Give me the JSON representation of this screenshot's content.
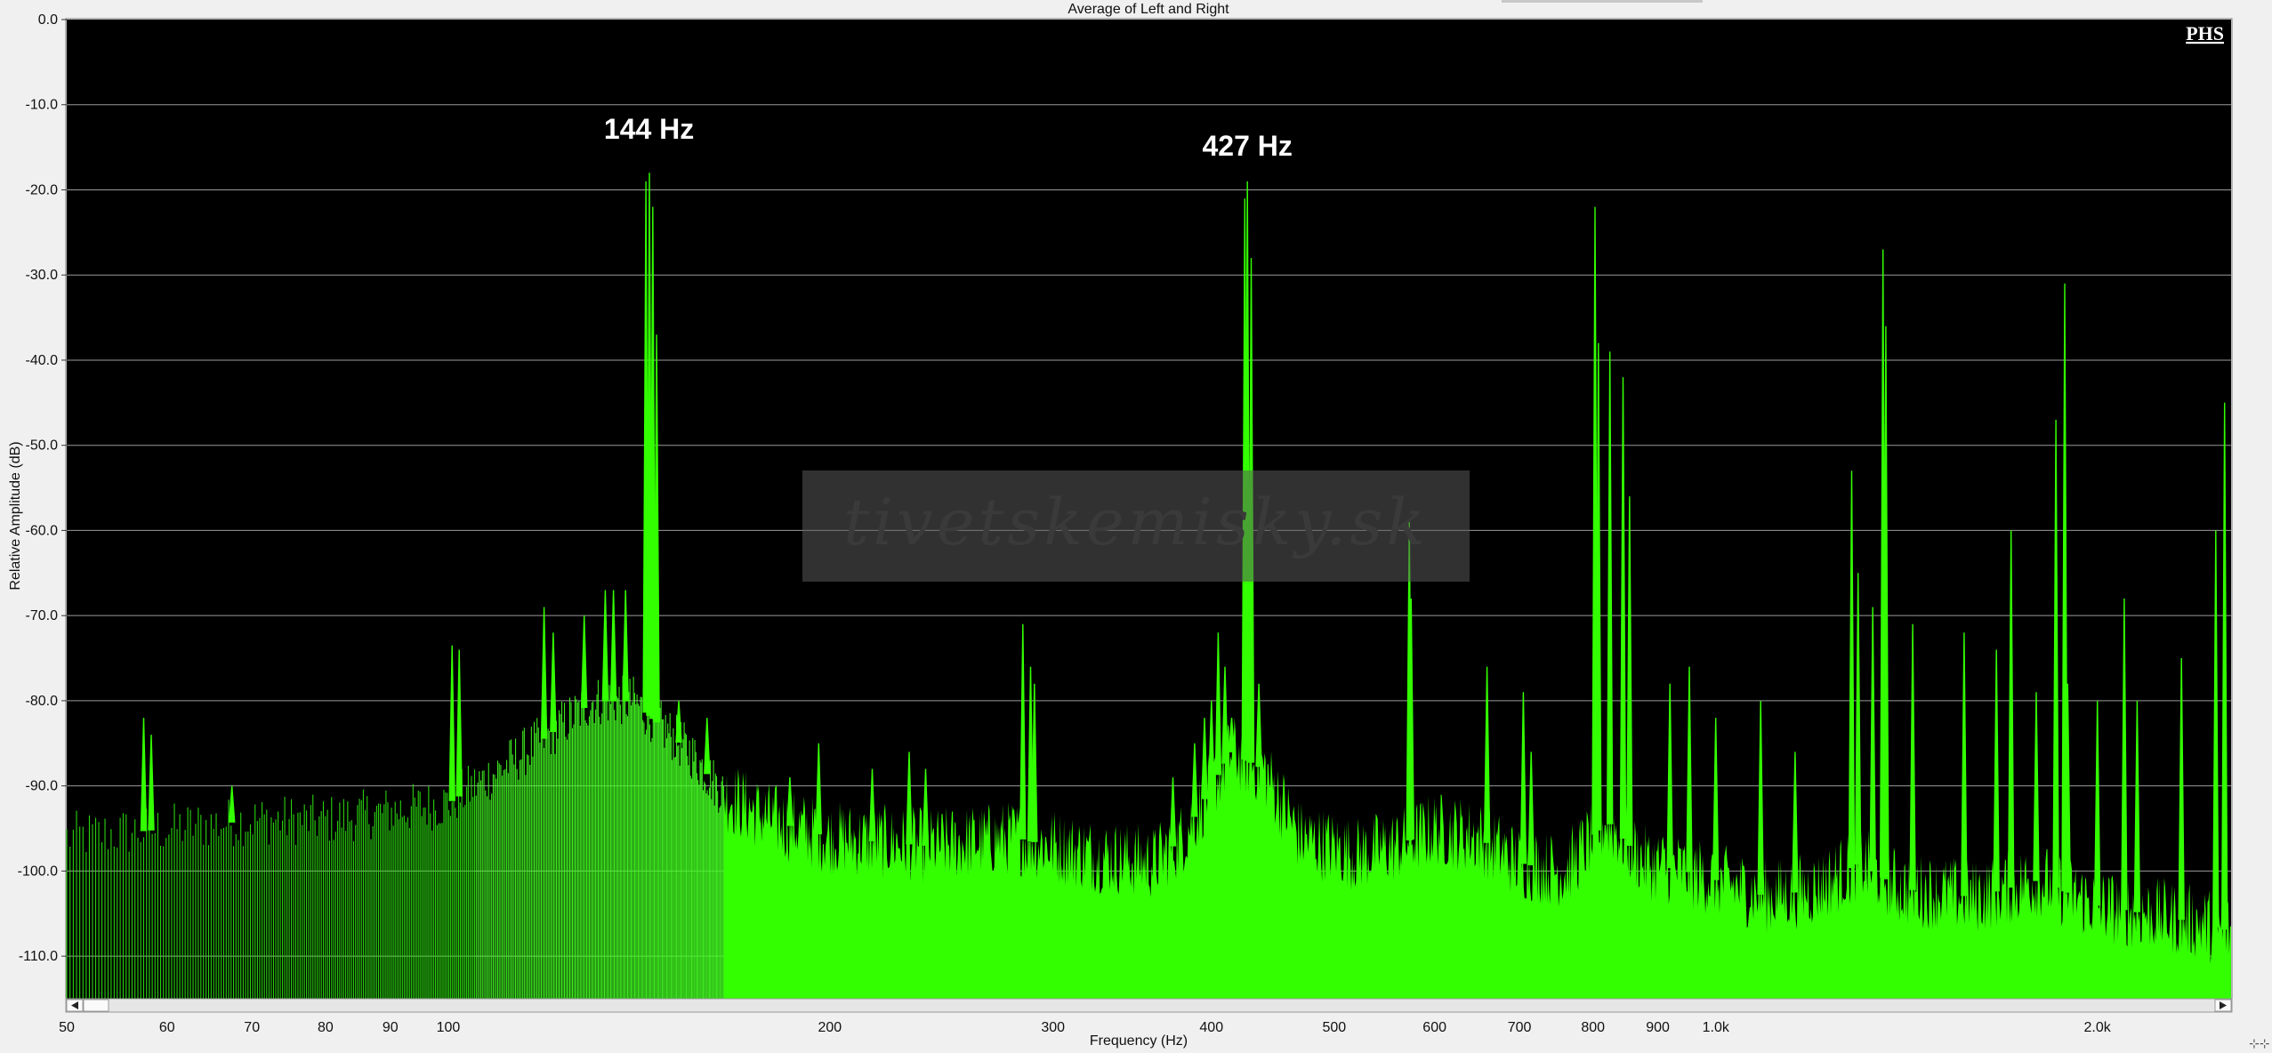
{
  "window": {
    "tab_stub": ""
  },
  "chart_data": {
    "type": "area",
    "title": "Average of Left and Right",
    "xlabel": "Frequency (Hz)",
    "ylabel": "Relative Amplitude (dB)",
    "xscale": "log",
    "xlim": [
      50,
      2550
    ],
    "ylim": [
      -115,
      0
    ],
    "grid": true,
    "background": "#000000",
    "fill_color": "#33ff00",
    "x_ticks": [
      {
        "value": 50,
        "label": "50"
      },
      {
        "value": 60,
        "label": "60"
      },
      {
        "value": 70,
        "label": "70"
      },
      {
        "value": 80,
        "label": "80"
      },
      {
        "value": 90,
        "label": "90"
      },
      {
        "value": 100,
        "label": "100"
      },
      {
        "value": 200,
        "label": "200"
      },
      {
        "value": 300,
        "label": "300"
      },
      {
        "value": 400,
        "label": "400"
      },
      {
        "value": 500,
        "label": "500"
      },
      {
        "value": 600,
        "label": "600"
      },
      {
        "value": 700,
        "label": "700"
      },
      {
        "value": 800,
        "label": "800"
      },
      {
        "value": 900,
        "label": "900"
      },
      {
        "value": 1000,
        "label": "1.0k"
      },
      {
        "value": 2000,
        "label": "2.0k"
      }
    ],
    "y_ticks": [
      {
        "value": 0,
        "label": "0.0"
      },
      {
        "value": -10,
        "label": "-10.0"
      },
      {
        "value": -20,
        "label": "-20.0"
      },
      {
        "value": -30,
        "label": "-30.0"
      },
      {
        "value": -40,
        "label": "-40.0"
      },
      {
        "value": -50,
        "label": "-50.0"
      },
      {
        "value": -60,
        "label": "-60.0"
      },
      {
        "value": -70,
        "label": "-70.0"
      },
      {
        "value": -80,
        "label": "-80.0"
      },
      {
        "value": -90,
        "label": "-90.0"
      },
      {
        "value": -100,
        "label": "-100.0"
      },
      {
        "value": -110,
        "label": "-110.0"
      }
    ],
    "annotations": [
      {
        "text": "144 Hz",
        "x": 144,
        "y": -14
      },
      {
        "text": "427 Hz",
        "x": 427,
        "y": -16
      }
    ],
    "brand_mark": "PHS",
    "watermark": "tivetskemisky.sk",
    "noise_floor": [
      [
        50,
        -96
      ],
      [
        60,
        -95
      ],
      [
        70,
        -94
      ],
      [
        80,
        -94
      ],
      [
        90,
        -93
      ],
      [
        100,
        -92
      ],
      [
        110,
        -88
      ],
      [
        120,
        -84
      ],
      [
        130,
        -80
      ],
      [
        140,
        -80
      ],
      [
        155,
        -86
      ],
      [
        165,
        -91
      ],
      [
        180,
        -94
      ],
      [
        200,
        -96
      ],
      [
        240,
        -97
      ],
      [
        280,
        -96
      ],
      [
        320,
        -98
      ],
      [
        360,
        -99
      ],
      [
        380,
        -96
      ],
      [
        400,
        -90
      ],
      [
        415,
        -86
      ],
      [
        440,
        -88
      ],
      [
        470,
        -96
      ],
      [
        520,
        -98
      ],
      [
        560,
        -97
      ],
      [
        600,
        -95
      ],
      [
        650,
        -96
      ],
      [
        700,
        -99
      ],
      [
        760,
        -100
      ],
      [
        820,
        -94
      ],
      [
        880,
        -99
      ],
      [
        950,
        -100
      ],
      [
        1000,
        -101
      ],
      [
        1100,
        -103
      ],
      [
        1200,
        -102
      ],
      [
        1300,
        -99
      ],
      [
        1400,
        -102
      ],
      [
        1600,
        -103
      ],
      [
        1800,
        -101
      ],
      [
        2000,
        -104
      ],
      [
        2200,
        -105
      ],
      [
        2400,
        -106
      ],
      [
        2550,
        -107
      ]
    ],
    "peaks": [
      {
        "x": 57.5,
        "y": -82
      },
      {
        "x": 58.3,
        "y": -84
      },
      {
        "x": 67.5,
        "y": -90
      },
      {
        "x": 100.7,
        "y": -73.5
      },
      {
        "x": 102,
        "y": -74
      },
      {
        "x": 119,
        "y": -69
      },
      {
        "x": 121,
        "y": -72
      },
      {
        "x": 128,
        "y": -70
      },
      {
        "x": 133,
        "y": -67
      },
      {
        "x": 135,
        "y": -67
      },
      {
        "x": 138,
        "y": -67
      },
      {
        "x": 143.2,
        "y": -19
      },
      {
        "x": 144.1,
        "y": -18
      },
      {
        "x": 145,
        "y": -22
      },
      {
        "x": 146,
        "y": -37
      },
      {
        "x": 152,
        "y": -80
      },
      {
        "x": 160,
        "y": -82
      },
      {
        "x": 186,
        "y": -89
      },
      {
        "x": 196,
        "y": -85
      },
      {
        "x": 216,
        "y": -88
      },
      {
        "x": 231,
        "y": -86
      },
      {
        "x": 238,
        "y": -88
      },
      {
        "x": 284,
        "y": -71
      },
      {
        "x": 288,
        "y": -76
      },
      {
        "x": 290,
        "y": -78
      },
      {
        "x": 373,
        "y": -89
      },
      {
        "x": 388,
        "y": -85
      },
      {
        "x": 395,
        "y": -82
      },
      {
        "x": 400,
        "y": -80
      },
      {
        "x": 405,
        "y": -72
      },
      {
        "x": 410,
        "y": -76
      },
      {
        "x": 415,
        "y": -82
      },
      {
        "x": 425,
        "y": -21
      },
      {
        "x": 427,
        "y": -19
      },
      {
        "x": 430,
        "y": -28
      },
      {
        "x": 436,
        "y": -78
      },
      {
        "x": 573,
        "y": -59
      },
      {
        "x": 575,
        "y": -68
      },
      {
        "x": 660,
        "y": -76
      },
      {
        "x": 705,
        "y": -79
      },
      {
        "x": 715,
        "y": -86
      },
      {
        "x": 803,
        "y": -22
      },
      {
        "x": 808,
        "y": -38
      },
      {
        "x": 825,
        "y": -39
      },
      {
        "x": 845,
        "y": -42
      },
      {
        "x": 855,
        "y": -56
      },
      {
        "x": 920,
        "y": -78
      },
      {
        "x": 953,
        "y": -76
      },
      {
        "x": 1000,
        "y": -82
      },
      {
        "x": 1085,
        "y": -80
      },
      {
        "x": 1155,
        "y": -86
      },
      {
        "x": 1280,
        "y": -53
      },
      {
        "x": 1295,
        "y": -65
      },
      {
        "x": 1330,
        "y": -69
      },
      {
        "x": 1355,
        "y": -27
      },
      {
        "x": 1362,
        "y": -36
      },
      {
        "x": 1430,
        "y": -71
      },
      {
        "x": 1570,
        "y": -72
      },
      {
        "x": 1665,
        "y": -74
      },
      {
        "x": 1710,
        "y": -60
      },
      {
        "x": 1790,
        "y": -79
      },
      {
        "x": 1855,
        "y": -47
      },
      {
        "x": 1885,
        "y": -31
      },
      {
        "x": 1895,
        "y": -78
      },
      {
        "x": 2000,
        "y": -80
      },
      {
        "x": 2100,
        "y": -68
      },
      {
        "x": 2150,
        "y": -80
      },
      {
        "x": 2330,
        "y": -75
      },
      {
        "x": 2480,
        "y": -60
      },
      {
        "x": 2520,
        "y": -45
      }
    ]
  }
}
